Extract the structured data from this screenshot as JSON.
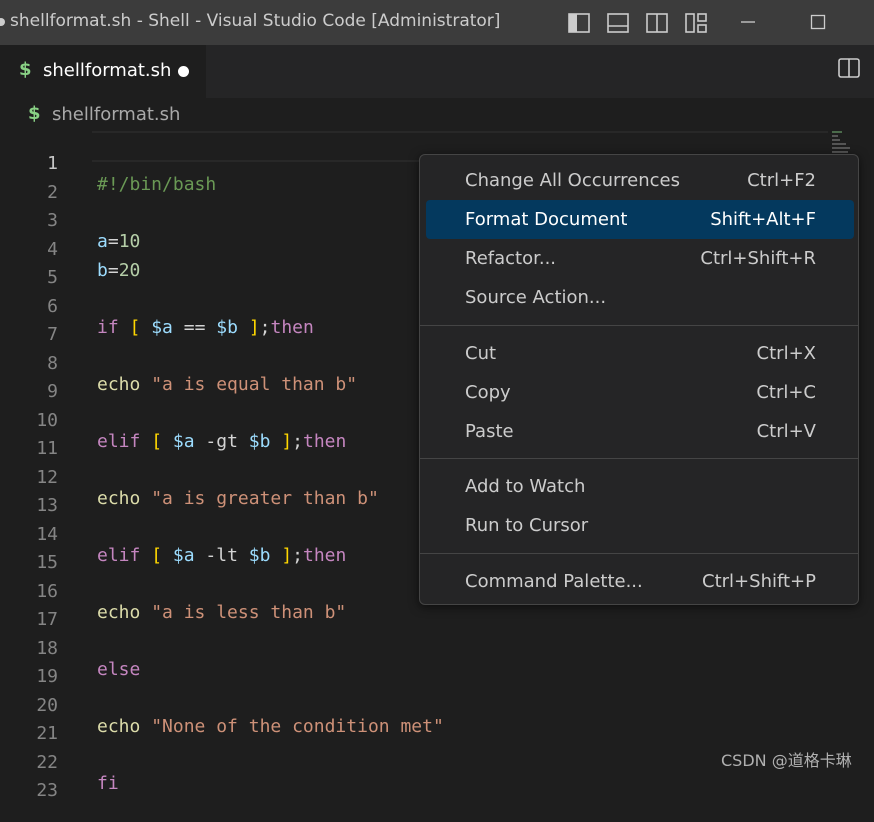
{
  "window": {
    "title": "shellformat.sh - Shell - Visual Studio Code [Administrator]"
  },
  "tab": {
    "icon": "$",
    "label": "shellformat.sh"
  },
  "breadcrumb": {
    "icon": "$",
    "label": "shellformat.sh"
  },
  "editor": {
    "line_numbers": [
      "1",
      "2",
      "3",
      "4",
      "5",
      "6",
      "7",
      "8",
      "9",
      "10",
      "11",
      "12",
      "13",
      "14",
      "15",
      "16",
      "17",
      "18",
      "19",
      "20",
      "21",
      "22",
      "23"
    ],
    "code": {
      "l1": "#!/bin/bash",
      "l3a": "a",
      "l3b": "=",
      "l3c": "10",
      "l4a": "b",
      "l4b": "=",
      "l4c": "20",
      "l6_if": "if",
      "l6_br1": "[",
      "l6_va": "$a",
      "l6_op": "==",
      "l6_vb": "$b",
      "l6_br2": "]",
      "l6_semi": ";",
      "l6_then": "then",
      "l8_echo": "echo",
      "l8_str": "\"a is equal than b\"",
      "l10_elif": "elif",
      "l10_br1": "[",
      "l10_va": "$a",
      "l10_op": "-gt",
      "l10_vb": "$b",
      "l10_br2": "]",
      "l10_semi": ";",
      "l10_then": "then",
      "l12_echo": "echo",
      "l12_str": "\"a is greater than b\"",
      "l14_elif": "elif",
      "l14_br1": "[",
      "l14_va": "$a",
      "l14_op": "-lt",
      "l14_vb": "$b",
      "l14_br2": "]",
      "l14_semi": ";",
      "l14_then": "then",
      "l16_echo": "echo",
      "l16_str": "\"a is less than b\"",
      "l18": "else",
      "l20_echo": "echo",
      "l20_str": "\"None of the condition met\"",
      "l22": "fi"
    }
  },
  "context_menu": {
    "items": [
      {
        "label": "Change All Occurrences",
        "shortcut": "Ctrl+F2"
      },
      {
        "label": "Format Document",
        "shortcut": "Shift+Alt+F"
      },
      {
        "label": "Refactor...",
        "shortcut": "Ctrl+Shift+R"
      },
      {
        "label": "Source Action...",
        "shortcut": ""
      },
      {
        "label": "Cut",
        "shortcut": "Ctrl+X"
      },
      {
        "label": "Copy",
        "shortcut": "Ctrl+C"
      },
      {
        "label": "Paste",
        "shortcut": "Ctrl+V"
      },
      {
        "label": "Add to Watch",
        "shortcut": ""
      },
      {
        "label": "Run to Cursor",
        "shortcut": ""
      },
      {
        "label": "Command Palette...",
        "shortcut": "Ctrl+Shift+P"
      }
    ],
    "selected_label": "Format Document"
  },
  "watermark": "CSDN @道格卡琳",
  "colors": {
    "accent_selection": "#04395e",
    "shell_icon": "#89d185"
  }
}
